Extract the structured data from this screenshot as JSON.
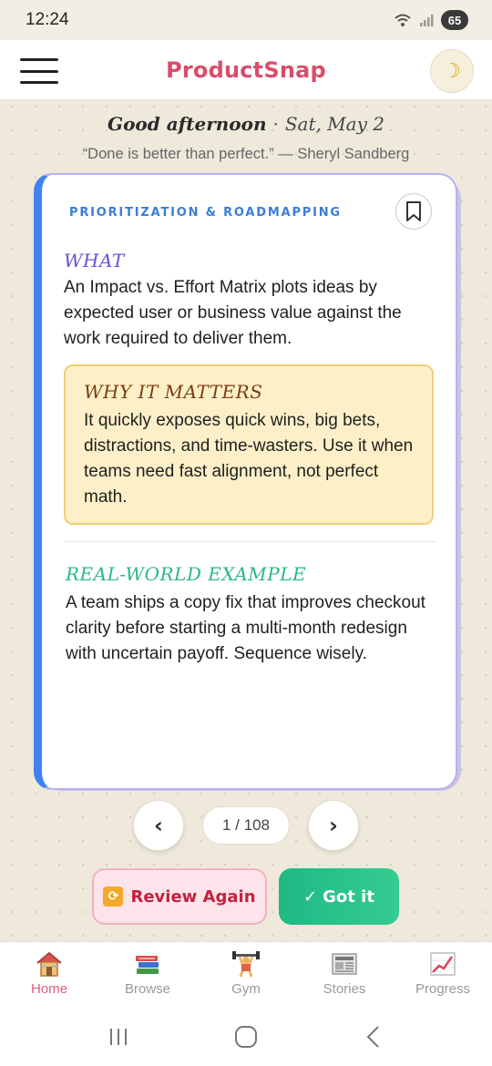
{
  "status": {
    "time": "12:24",
    "battery": "65"
  },
  "header": {
    "title": "ProductSnap",
    "theme_icon": "moon-icon"
  },
  "greeting": {
    "hello": "Good afternoon",
    "separator": "·",
    "date": "Sat, May 2"
  },
  "quote": "“Done is better than perfect.” — Sheryl Sandberg",
  "card": {
    "category": "PRIORITIZATION & ROADMAPPING",
    "what_heading": "WHAT",
    "what_text": "An Impact vs. Effort Matrix plots ideas by expected user or business value against the work required to deliver them.",
    "why_heading": "WHY IT MATTERS",
    "why_text": "It quickly exposes quick wins, big bets, distractions, and time-wasters. Use it when teams need fast alignment, not perfect math.",
    "example_heading": "REAL-WORLD EXAMPLE",
    "example_text": "A team ships a copy fix that improves checkout clarity before starting a multi-month redesign with uncertain payoff. Sequence wisely."
  },
  "pager": {
    "prev": "‹",
    "count": "1 / 108",
    "next": "›"
  },
  "actions": {
    "review_icon": "🔁",
    "review_label": "Review Again",
    "gotit_check": "✓",
    "gotit_label": "Got it"
  },
  "nav": {
    "items": [
      {
        "label": "Home",
        "icon": "house-icon"
      },
      {
        "label": "Browse",
        "icon": "books-icon"
      },
      {
        "label": "Gym",
        "icon": "weightlifter-icon"
      },
      {
        "label": "Stories",
        "icon": "newspaper-icon"
      },
      {
        "label": "Progress",
        "icon": "chart-increasing-icon"
      }
    ]
  },
  "colors": {
    "brand": "#d94d6a",
    "accent_blue": "#3f82f0",
    "success": "#1fb985",
    "background": "#efe9dc"
  }
}
